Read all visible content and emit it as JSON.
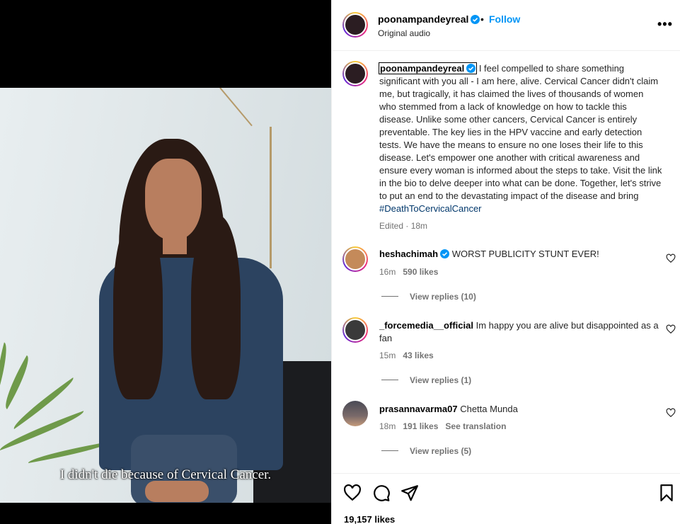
{
  "video": {
    "subtitle": "I didn't die because of Cervical Cancer."
  },
  "header": {
    "username": "poonampandeyreal",
    "separator": "•",
    "follow_label": "Follow",
    "audio_label": "Original audio",
    "more_label": "•••"
  },
  "caption": {
    "username": "poonampandeyreal",
    "text": " I feel compelled to share something significant with you all - I am here, alive. Cervical Cancer didn't claim me, but tragically, it has claimed the lives of thousands of women who stemmed from a lack of knowledge on how to tackle this disease. Unlike some other cancers, Cervical Cancer is entirely preventable. The key lies in the HPV vaccine and early detection tests. We have the means to ensure no one loses their life to this disease. Let's empower one another with critical awareness and ensure every woman is informed about the steps to take. Visit the link in the bio to delve deeper into what can be done. Together, let's strive to put an end to the devastating impact of the disease and bring ",
    "hashtag": "#DeathToCervicalCancer",
    "meta": "Edited · 18m"
  },
  "comments": [
    {
      "username": "heshachimah",
      "text": "WORST PUBLICITY STUNT EVER!",
      "time": "16m",
      "likes": "590 likes",
      "replies": "View replies (10)"
    },
    {
      "username": "_forcemedia__official",
      "text": "Im happy you are alive but disappointed as a fan",
      "time": "15m",
      "likes": "43 likes",
      "replies": "View replies (1)"
    },
    {
      "username": "prasannavarma07",
      "text": "Chetta Munda",
      "time": "18m",
      "likes": "191 likes",
      "translate": "See translation",
      "replies": "View replies (5)"
    }
  ],
  "footer": {
    "likes": "19,157 likes"
  },
  "colors": {
    "link_blue": "#0095f6",
    "hashtag": "#00376b",
    "verified": "#0095f6",
    "meta_gray": "#737373"
  }
}
